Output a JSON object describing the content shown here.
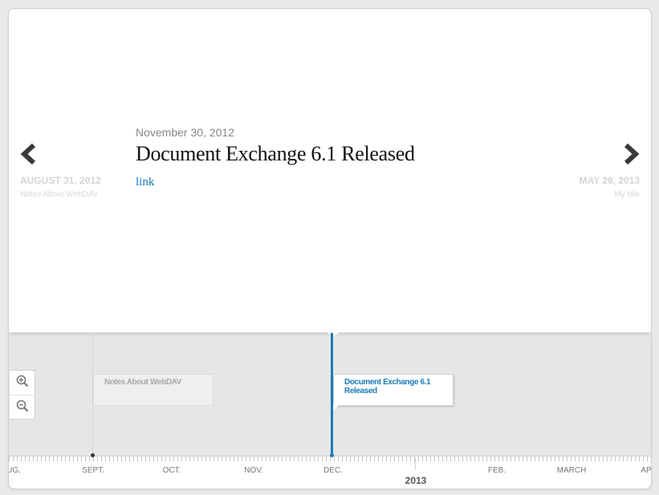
{
  "slider": {
    "current": {
      "date": "November 30, 2012",
      "headline": "Document Exchange 6.1 Released",
      "link_label": "link"
    },
    "previous": {
      "date": "AUGUST 31, 2012",
      "title": "Notes About WebDAV"
    },
    "next": {
      "date": "MAY 28, 2013",
      "title": "My title"
    },
    "prev_icon": "chevron-left-icon",
    "next_icon": "chevron-right-icon"
  },
  "navigation": {
    "zoom_in_icon": "zoom-in-icon",
    "zoom_out_icon": "zoom-out-icon",
    "flags": [
      {
        "label": "Notes About WebDAV",
        "active": false
      },
      {
        "label": "Document Exchange 6.1 Released",
        "active": true
      }
    ],
    "axis": {
      "months": [
        "UG.",
        "SEPT.",
        "OCT.",
        "NOV.",
        "DEC.",
        "FEB.",
        "MARCH",
        "AP"
      ],
      "year": "2013"
    }
  },
  "colors": {
    "accent": "#1a7bb8",
    "background": "#e9e9e9",
    "slide": "#ffffff"
  }
}
